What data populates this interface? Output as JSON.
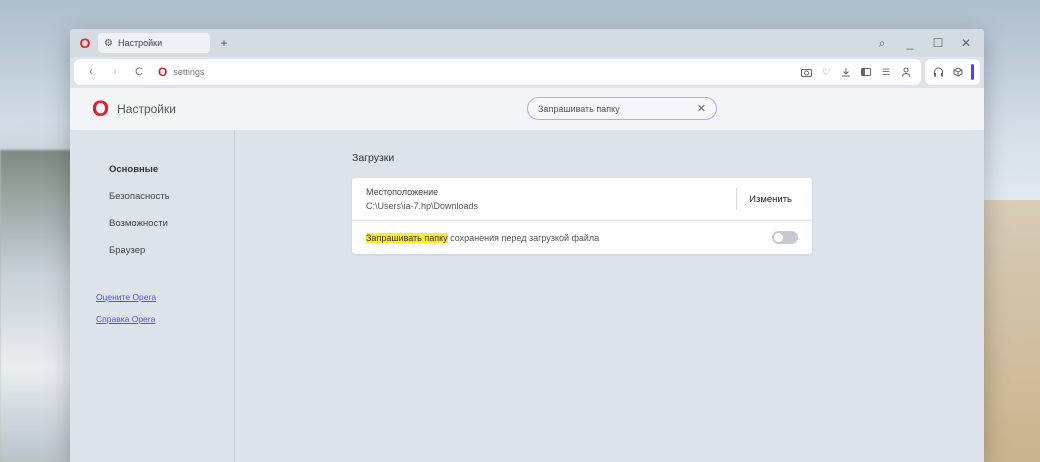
{
  "window": {
    "menu_logo": "O",
    "tab_title": "Настройки",
    "new_tab": "+"
  },
  "window_controls": {
    "search": "⌕",
    "minimize": "_",
    "maximize": "☐",
    "close": "✕"
  },
  "addressbar": {
    "back": "‹",
    "forward": "›",
    "reload": "C",
    "url_logo": "O",
    "url": "settings"
  },
  "settings": {
    "logo": "O",
    "title": "Настройки",
    "search_value": "Запрашивать папку",
    "search_clear": "✕"
  },
  "sidebar": {
    "items": [
      {
        "label": "Основные"
      },
      {
        "label": "Безопасность"
      },
      {
        "label": "Возможности"
      },
      {
        "label": "Браузер"
      }
    ],
    "links": [
      {
        "label": "Оцените Opera"
      },
      {
        "label": "Справка Opera"
      }
    ]
  },
  "main": {
    "section_title": "Загрузки",
    "location_label": "Местоположение",
    "location_path": "C:\\Users\\ia-7.hp\\Downloads",
    "change_button": "Изменить",
    "ask_highlight": "Запрашивать папку",
    "ask_rest": " сохранения перед загрузкой файла",
    "ask_enabled": false
  },
  "colors": {
    "opera_red": "#e0212b",
    "accent": "#5a3ff0",
    "highlight": "#ffeb2e"
  }
}
